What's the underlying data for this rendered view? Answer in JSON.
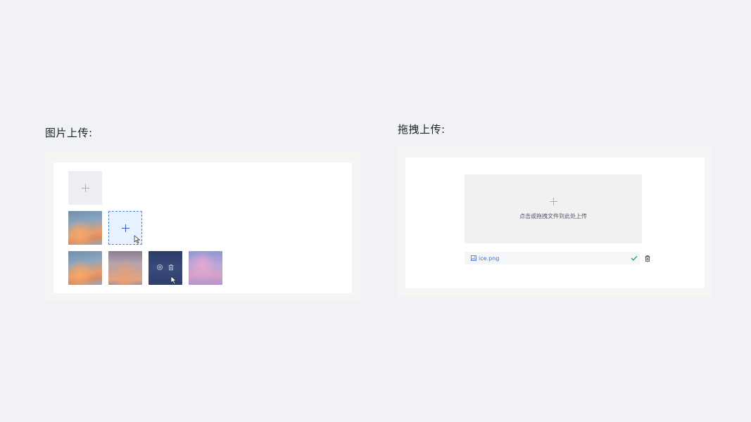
{
  "image_upload": {
    "title": "图片上传:",
    "images": [
      "sunset-orange",
      "sunset-purple",
      "night-sky",
      "pink-sky"
    ]
  },
  "drag_upload": {
    "title": "拖拽上传:",
    "drop_text": "点击或拖拽文件到此处上传",
    "file": {
      "name": "ice.png",
      "status": "success"
    }
  },
  "icons": {
    "add": "plus-icon",
    "cursor": "pointer-cursor-icon",
    "preview": "eye-icon",
    "delete": "trash-icon",
    "file": "image-file-icon",
    "success": "check-icon"
  },
  "colors": {
    "background": "#f0f2f5",
    "accent": "#2e5fc7",
    "link": "#3a6fd8",
    "success": "#1aa35c"
  }
}
